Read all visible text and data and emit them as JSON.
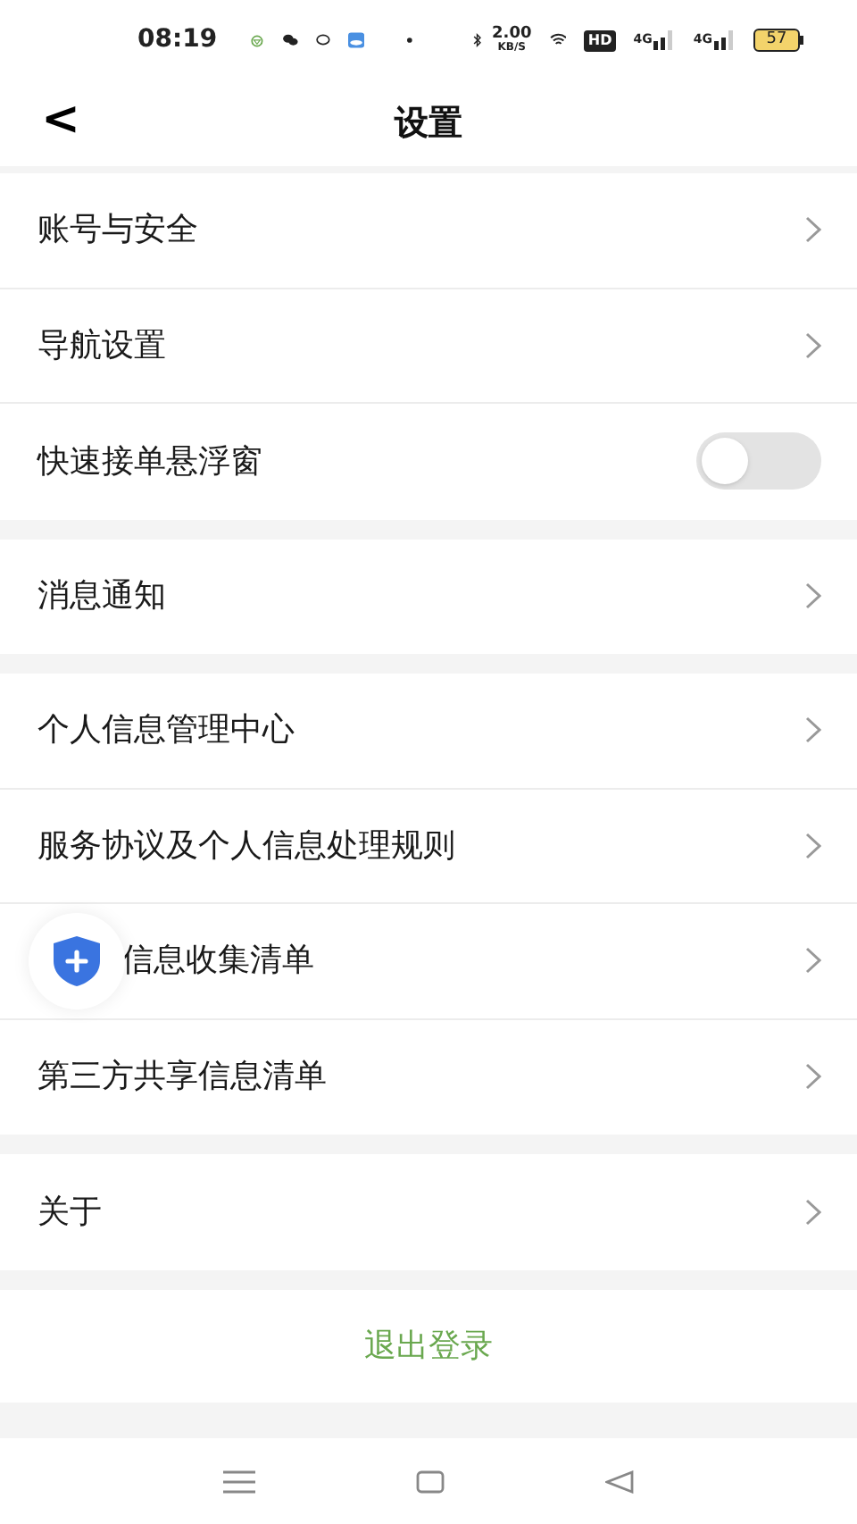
{
  "status_bar": {
    "time": "08:19",
    "speed": "2.00",
    "speed_unit": "KB/S",
    "hd": "HD",
    "networks": [
      "4G",
      "4G"
    ],
    "battery": "57"
  },
  "header": {
    "back": "<",
    "title": "设置"
  },
  "groups": [
    {
      "items": [
        {
          "label": "账号与安全",
          "kind": "link"
        },
        {
          "label": "导航设置",
          "kind": "link"
        },
        {
          "label": "快速接单悬浮窗",
          "kind": "toggle",
          "on": false
        }
      ]
    },
    {
      "items": [
        {
          "label": "消息通知",
          "kind": "link"
        }
      ]
    },
    {
      "items": [
        {
          "label": "个人信息管理中心",
          "kind": "link"
        },
        {
          "label": "服务协议及个人信息处理规则",
          "kind": "link"
        },
        {
          "label": "信息收集清单",
          "kind": "covered"
        },
        {
          "label": "第三方共享信息清单",
          "kind": "link"
        }
      ]
    },
    {
      "items": [
        {
          "label": "关于",
          "kind": "link"
        }
      ]
    }
  ],
  "logout": "退出登录"
}
